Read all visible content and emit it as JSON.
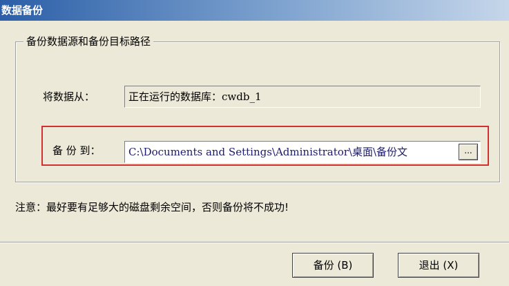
{
  "window": {
    "title": "数据备份"
  },
  "group": {
    "legend": "备份数据源和备份目标路径"
  },
  "source": {
    "label": "将数据从：",
    "value": "正在运行的数据库：cwdb_1"
  },
  "destination": {
    "label": "备 份 到：",
    "value": "C:\\Documents and Settings\\Administrator\\桌面\\备份文",
    "browse_label": "..."
  },
  "note": "注意：最好要有足够大的磁盘剩余空间，否则备份将不成功!",
  "buttons": {
    "backup_label": "备份 (B)",
    "exit_label": "退出 (X)"
  },
  "colors": {
    "title_gradient_start": "#2c5fa8",
    "highlight_border": "#d03030"
  }
}
